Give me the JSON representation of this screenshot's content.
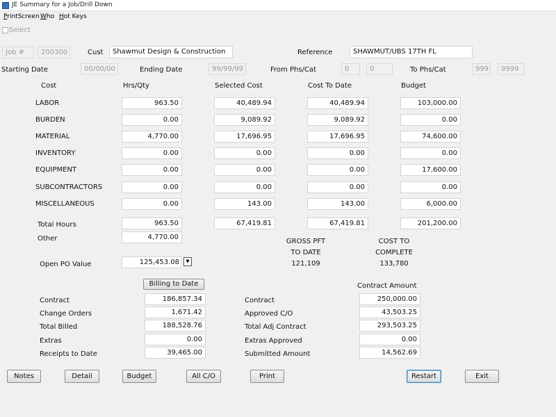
{
  "window": {
    "title": "JE  Summary for a Job/Drill Down"
  },
  "menu": [
    "PrintScreen",
    "Who",
    "Hot Keys"
  ],
  "select_label": "Select",
  "header": {
    "job_label": "Job #",
    "job_value": "200300",
    "cust_label": "Cust",
    "cust_value": "Shawmut Design & Construction",
    "reference_label": "Reference",
    "reference_value": "SHAWMUT/UBS 17TH FL",
    "starting_date_label": "Starting Date",
    "starting_date_value": "00/00/00",
    "ending_date_label": "Ending Date",
    "ending_date_value": "99/99/99",
    "from_phs_label": "From Phs/Cat",
    "from_phs_value": "0",
    "from_cat_value": "0",
    "to_phs_label": "To Phs/Cat",
    "to_phs_value": "999",
    "to_cat_value": "9999"
  },
  "grid": {
    "columns": [
      "Cost",
      "Hrs/Qty",
      "Selected Cost",
      "Cost To Date",
      "Budget"
    ],
    "rows": [
      {
        "label": "LABOR",
        "hrs": "963.50",
        "selected": "40,489.94",
        "to_date": "40,489.94",
        "budget": "103,000.00"
      },
      {
        "label": "BURDEN",
        "hrs": "0.00",
        "selected": "9,089.92",
        "to_date": "9,089.92",
        "budget": "0.00"
      },
      {
        "label": "MATERIAL",
        "hrs": "4,770.00",
        "selected": "17,696.95",
        "to_date": "17,696.95",
        "budget": "74,600.00"
      },
      {
        "label": "INVENTORY",
        "hrs": "0.00",
        "selected": "0.00",
        "to_date": "0.00",
        "budget": "0.00"
      },
      {
        "label": "EQUIPMENT",
        "hrs": "0.00",
        "selected": "0.00",
        "to_date": "0.00",
        "budget": "17,600.00"
      },
      {
        "label": "SUBCONTRACTORS",
        "hrs": "0.00",
        "selected": "0.00",
        "to_date": "0.00",
        "budget": "0.00"
      },
      {
        "label": "MISCELLANEOUS",
        "hrs": "0.00",
        "selected": "143.00",
        "to_date": "143.00",
        "budget": "6,000.00"
      }
    ],
    "total_label": "Total Hours",
    "total_hrs": "963.50",
    "total_selected": "67,419.81",
    "total_to_date": "67,419.81",
    "total_budget": "201,200.00",
    "other_label": "Other",
    "other_value": "4,770.00"
  },
  "gross_pft": {
    "line1": "GROSS PFT",
    "line2": "TO DATE",
    "value": "121,109"
  },
  "cost_to_complete": {
    "line1": "COST TO",
    "line2": "COMPLETE",
    "value": "133,780"
  },
  "open_po": {
    "label": "Open PO Value",
    "value": "125,453.08",
    "dropdown_icon": "down-triangle"
  },
  "billing": {
    "button_label": "Billing to Date",
    "rows": [
      {
        "label": "Contract",
        "value": "186,857.34"
      },
      {
        "label": "Change Orders",
        "value": "1,671.42"
      },
      {
        "label": "Total Billed",
        "value": "188,528.76"
      },
      {
        "label": "Extras",
        "value": "0.00"
      },
      {
        "label": "Receipts to Date",
        "value": "39,465.00"
      }
    ]
  },
  "contract": {
    "header": "Contract Amount",
    "rows": [
      {
        "label": "Contract",
        "value": "250,000.00"
      },
      {
        "label": "Approved C/O",
        "value": "43,503.25"
      },
      {
        "label": "Total Adj Contract",
        "value": "293,503.25"
      },
      {
        "label": "Extras Approved",
        "value": "0.00"
      },
      {
        "label": "Submitted Amount",
        "value": "14,562.69"
      }
    ]
  },
  "buttons": {
    "notes": "Notes",
    "detail": "Detail",
    "budget": "Budget",
    "all_co": "All C/O",
    "print": "Print",
    "restart": "Restart",
    "exit": "Exit"
  }
}
